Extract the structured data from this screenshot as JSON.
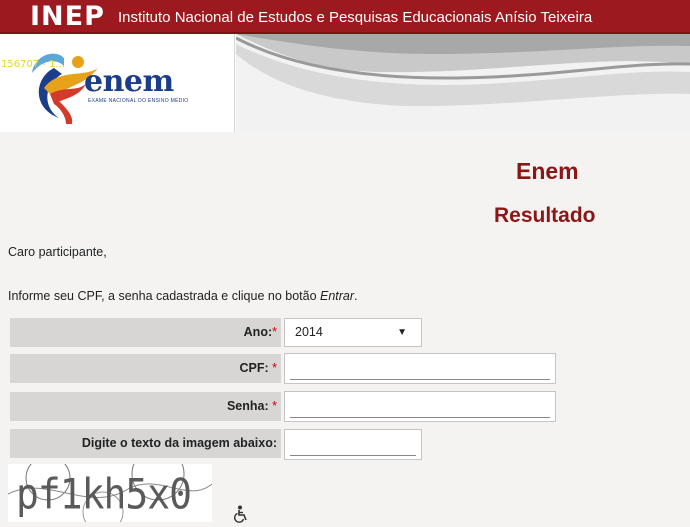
{
  "header": {
    "logo_text": "INEP",
    "institution": "Instituto Nacional de Estudos e Pesquisas Educacionais Anísio Teixeira"
  },
  "banner": {
    "counter": "156707 - 1...",
    "enem_logo": "enem",
    "enem_subtitle": "EXAME NACIONAL DO ENSINO MÉDIO"
  },
  "page": {
    "title": "Enem",
    "subtitle": "Resultado",
    "greeting": "Caro participante,",
    "instruction_prefix": "Informe seu CPF, a senha cadastrada e clique no botão ",
    "instruction_action": "Entrar",
    "instruction_suffix": "."
  },
  "form": {
    "ano_label": "Ano:",
    "ano_value": "2014",
    "cpf_label": "CPF: ",
    "cpf_value": "",
    "senha_label": "Senha: ",
    "senha_value": "",
    "captcha_label": "Digite o texto da imagem abaixo:",
    "captcha_value": "",
    "required_mark": "*"
  },
  "captcha": {
    "text": "pf1kh5x0"
  },
  "icons": {
    "dropdown": "chevron-down-icon",
    "accessibility": "wheelchair-icon"
  },
  "colors": {
    "header_red": "#9c1a1f",
    "title_red": "#8c1515",
    "label_bg": "#d7d6d5",
    "enem_blue": "#1c3d8a"
  }
}
